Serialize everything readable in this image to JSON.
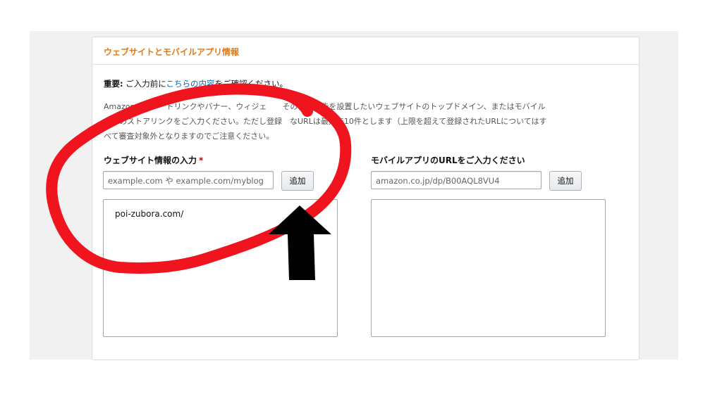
{
  "section_title": "ウェブサイトとモバイルアプリ情報",
  "notice": {
    "prefix": "重要:",
    "before_link": " ご入力前に",
    "link": "こちらの内容",
    "after_link": "をご確認ください。"
  },
  "description": {
    "line1": "Amazon　　　　トリンクやバナー、ウィジェ　　その他の広告を設置したいウェブサイトのトップドメイン、またはモバイル",
    "line2": "　　のストアリンクをご入力ください。ただし登録　なURLは最大で10件とします（上限を超えて登録されたURLについてはす",
    "line3": "べて審査対象外となりますのでご注意ください。"
  },
  "website": {
    "label": "ウェブサイト情報の入力",
    "required_mark": "*",
    "placeholder": "example.com や example.com/myblog",
    "add_button": "追加",
    "entries": [
      "poi-zubora.com/"
    ]
  },
  "mobile": {
    "label": "モバイルアプリのURLをご入力ください",
    "placeholder": "amazon.co.jp/dp/B00AQL8VU4",
    "add_button": "追加"
  },
  "annotation": {
    "circle_color": "#f0141e",
    "arrow_color": "#000000"
  }
}
